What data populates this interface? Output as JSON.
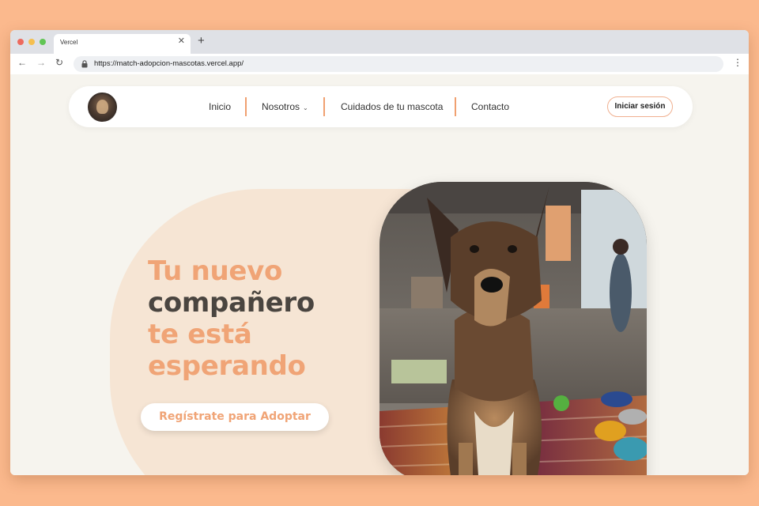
{
  "browser": {
    "tab_title": "Vercel",
    "tab_close": "✕",
    "new_tab": "+",
    "url": "https://match-adopcion-mascotas.vercel.app/",
    "back": "←",
    "forward": "→",
    "reload": "↻",
    "menu": "⋮",
    "lock": "🔒"
  },
  "nav": {
    "items": [
      "Inicio",
      "Nosotros",
      "Cuidados de tu mascota",
      "Contacto"
    ],
    "dropdown_chevron": "⌄",
    "login_label": "Iniciar sesión"
  },
  "hero": {
    "line1": "Tu nuevo",
    "line2": "compañero",
    "line3": "te está",
    "line4": "esperando",
    "cta_label": "Regístrate para Adoptar"
  },
  "colors": {
    "accent": "#f0a476",
    "dark_text": "#4a4540",
    "page_bg": "#f6f4ee",
    "outer_bg": "#fbb98d"
  },
  "icons": {
    "logo": "pet-logo-icon",
    "hero_image": "dog-photo"
  }
}
